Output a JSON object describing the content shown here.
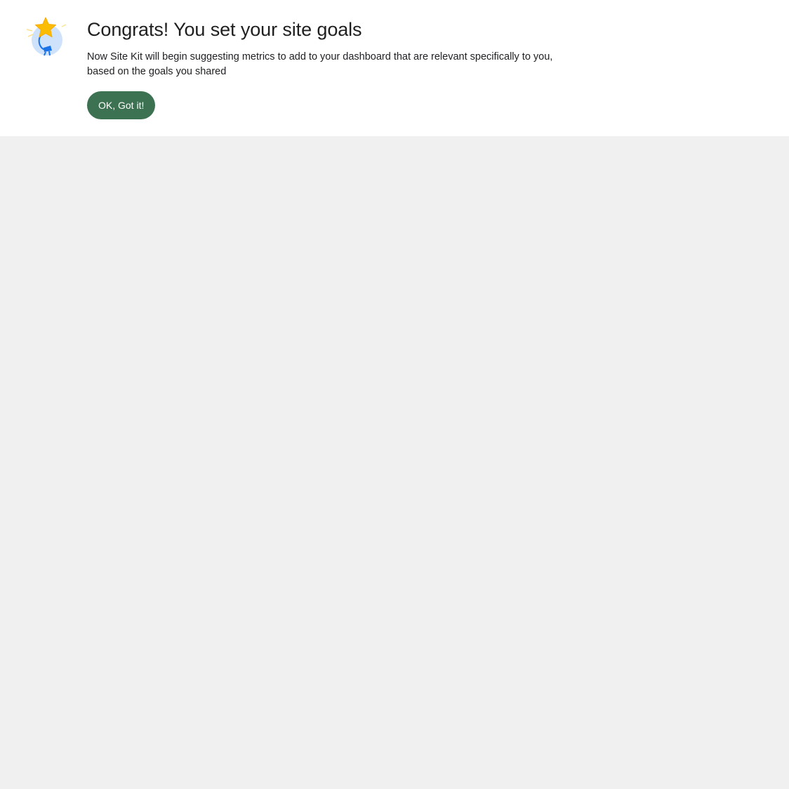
{
  "banner": {
    "illustration_icon": "star-celebration-icon",
    "title": "Congrats! You set your site goals",
    "description": "Now Site Kit will begin suggesting metrics to add to your dashboard that are relevant specifically to you, based on the goals you shared",
    "cta_label": "OK, Got it!"
  },
  "colors": {
    "banner_background": "#ffffff",
    "page_background": "#f0f0f0",
    "button_background": "#3c7251",
    "button_text": "#ffffff",
    "star": "#fbbc04",
    "circle": "#cfe2fb",
    "figure": "#1a73e8"
  }
}
